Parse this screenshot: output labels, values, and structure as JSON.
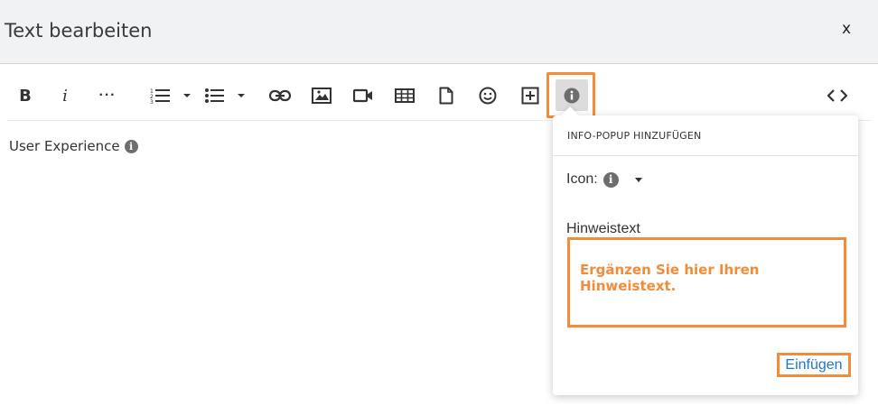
{
  "header": {
    "title": "Text bearbeiten",
    "close_label": "x"
  },
  "toolbar": {
    "bold_label": "B",
    "italic_label": "i",
    "more_label": "···",
    "buttons": [
      "bold",
      "italic",
      "more",
      "ordered-list",
      "unordered-list",
      "link",
      "image",
      "video",
      "table",
      "file",
      "emoji",
      "special-char",
      "info-popup",
      "code-view"
    ]
  },
  "editor": {
    "content_text": "User Experience",
    "info_icon": "i"
  },
  "popup": {
    "title": "INFO-POPUP HINZUFÜGEN",
    "icon_label": "Icon:",
    "icon_glyph": "i",
    "hint_label": "Hinweistext",
    "hint_value": "Ergänzen Sie hier Ihren Hinweistext.",
    "insert_label": "Einfügen"
  },
  "colors": {
    "highlight": "#f28c38",
    "link": "#1f77c9",
    "header_bg": "#f1f2f4"
  }
}
